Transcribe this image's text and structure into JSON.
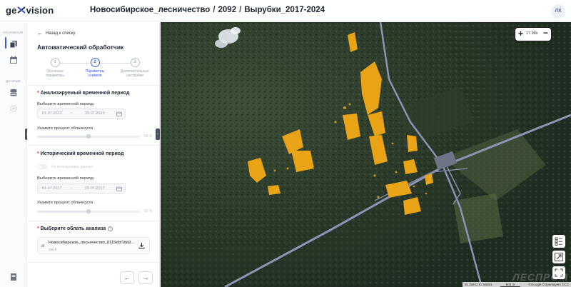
{
  "header": {
    "logo_left": "ge",
    "logo_right": "vision",
    "breadcrumbs": [
      "Новосибирское_лесничество",
      "2092",
      "Вырубки_2017-2024"
    ],
    "separator": "/",
    "avatar_initials": "ЛК"
  },
  "rail": {
    "section_main": "ОСНОВНОЕ",
    "section_data": "ДАННЫЕ",
    "items": [
      "layers-icon",
      "calendar-icon",
      "database-icon",
      "settings-icon"
    ],
    "bottom_icon": "book-icon"
  },
  "panel": {
    "back_label": "Назад к списку",
    "title": "Автоматический обработчик",
    "steps": [
      {
        "num": "1",
        "label_line1": "Основные",
        "label_line2": "параметры",
        "state": "done"
      },
      {
        "num": "2",
        "label_line1": "Параметры",
        "label_line2": "снимков",
        "state": "active"
      },
      {
        "num": "3",
        "label_line1": "Дополнительные",
        "label_line2": "настройки",
        "state": "pending"
      }
    ],
    "analyzed": {
      "title": "Анализируемый временной период",
      "period_label": "Выберите временной период",
      "date_from": "01.07.2023",
      "date_to": "29.07.2023",
      "cloud_label": "Укажите процент облачности",
      "cloud_value": "50 %",
      "cloud_fraction": 0.5
    },
    "historical": {
      "title": "Исторический временной период",
      "toggle_label": "Не использовать данные",
      "period_label": "Выберите временной период",
      "date_from": "01.07.2017",
      "date_to": "29.07.2017",
      "cloud_label": "Укажите процент облачности",
      "cloud_value": "50 %",
      "cloud_fraction": 0.5
    },
    "area": {
      "title": "Выберите облать анализа",
      "file_name": "Новосибирское_лесничество_0115ebf1da9...",
      "file_size": "234 б"
    },
    "prev_icon": "arrow-left-icon",
    "next_icon": "arrow-right-icon"
  },
  "map": {
    "zoom_value": "17.98х",
    "attribution_coords": "55.15842 82.55591",
    "attribution_scale": "500 m",
    "attribution_credits": "©Google ©Openlayers ©CC",
    "watermark": "ЛЕСПРОМ",
    "buttons": [
      "legend-icon",
      "fit-extent-icon",
      "fullscreen-icon"
    ],
    "accent": "#e8a317"
  }
}
